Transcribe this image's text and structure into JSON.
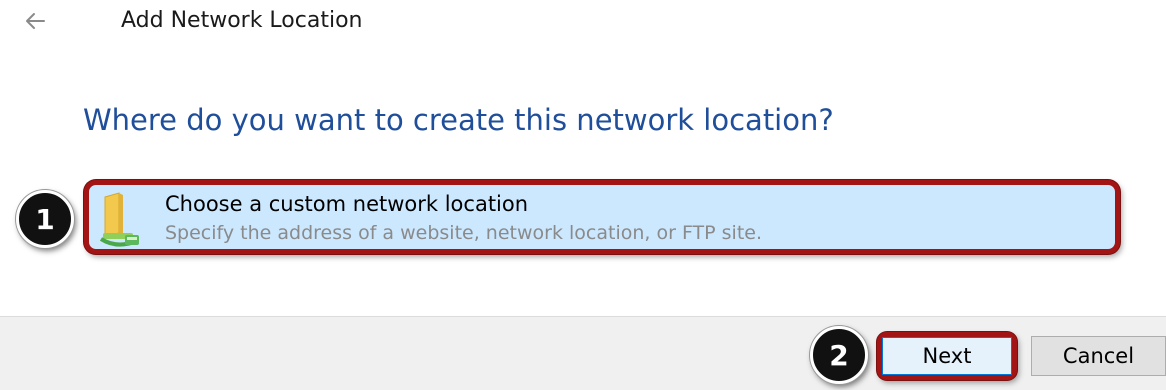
{
  "header": {
    "back_icon": "back-arrow-icon",
    "title": "Add Network Location"
  },
  "main": {
    "question": "Where do you want to create this network location?",
    "option": {
      "icon": "network-folder-icon",
      "title": "Choose a custom network location",
      "description": "Specify the address of a website, network location, or FTP site."
    }
  },
  "annotations": {
    "step1": "1",
    "step2": "2",
    "highlight_color": "#a31515"
  },
  "footer": {
    "next_label": "Next",
    "cancel_label": "Cancel"
  },
  "colors": {
    "question_text": "#1f4e9a",
    "option_selected_bg": "#cce8ff"
  }
}
